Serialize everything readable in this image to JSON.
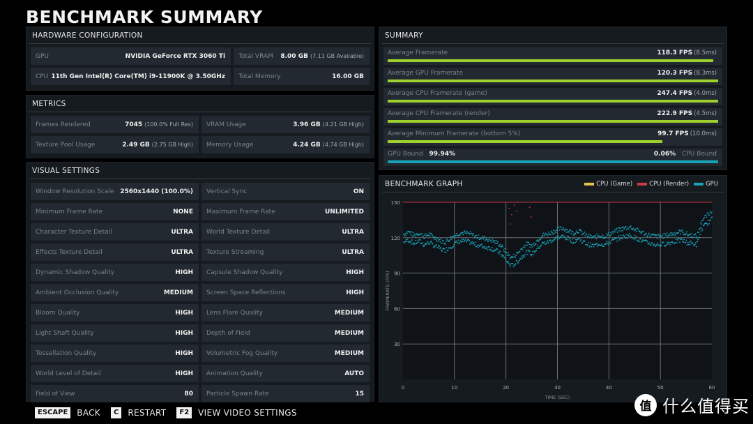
{
  "title": "BENCHMARK SUMMARY",
  "hardware": {
    "title": "HARDWARE CONFIGURATION",
    "items": [
      {
        "label": "GPU",
        "value": "NVIDIA GeForce RTX 3060 Ti",
        "sub": ""
      },
      {
        "label": "Total VRAM",
        "value": "8.00 GB",
        "sub": "(7.11 GB Available)"
      },
      {
        "label": "CPU",
        "value": "11th Gen Intel(R) Core(TM) i9-11900K @ 3.50GHz",
        "sub": ""
      },
      {
        "label": "Total Memory",
        "value": "16.00 GB",
        "sub": ""
      }
    ]
  },
  "metrics": {
    "title": "METRICS",
    "items": [
      {
        "label": "Frames Rendered",
        "value": "7045",
        "sub": "(100.0% Full Res)"
      },
      {
        "label": "VRAM Usage",
        "value": "3.96 GB",
        "sub": "(4.21 GB High)"
      },
      {
        "label": "Texture Pool Usage",
        "value": "2.49 GB",
        "sub": "(2.75 GB High)"
      },
      {
        "label": "Memory Usage",
        "value": "4.24 GB",
        "sub": "(4.74 GB High)"
      }
    ]
  },
  "visual": {
    "title": "VISUAL SETTINGS",
    "items": [
      {
        "label": "Window Resolution Scale",
        "value": "2560x1440 (100.0%)"
      },
      {
        "label": "Vertical Sync",
        "value": "ON"
      },
      {
        "label": "Minimum Frame Rate",
        "value": "NONE"
      },
      {
        "label": "Maximum Frame Rate",
        "value": "UNLIMITED"
      },
      {
        "label": "Character Texture Detail",
        "value": "ULTRA"
      },
      {
        "label": "World Texture Detail",
        "value": "ULTRA"
      },
      {
        "label": "Effects Texture Detail",
        "value": "ULTRA"
      },
      {
        "label": "Texture Streaming",
        "value": "ULTRA"
      },
      {
        "label": "Dynamic Shadow Quality",
        "value": "HIGH"
      },
      {
        "label": "Capsule Shadow Quality",
        "value": "HIGH"
      },
      {
        "label": "Ambient Occlusion Quality",
        "value": "MEDIUM"
      },
      {
        "label": "Screen Space Reflections",
        "value": "HIGH"
      },
      {
        "label": "Bloom Quality",
        "value": "HIGH"
      },
      {
        "label": "Lens Flare Quality",
        "value": "MEDIUM"
      },
      {
        "label": "Light Shaft Quality",
        "value": "HIGH"
      },
      {
        "label": "Depth of Field",
        "value": "MEDIUM"
      },
      {
        "label": "Tessellation Quality",
        "value": "HIGH"
      },
      {
        "label": "Volumetric Fog Quality",
        "value": "MEDIUM"
      },
      {
        "label": "World Level of Detail",
        "value": "HIGH"
      },
      {
        "label": "Animation Quality",
        "value": "AUTO"
      },
      {
        "label": "Field of View",
        "value": "80"
      },
      {
        "label": "Particle Spawn Rate",
        "value": "15"
      }
    ]
  },
  "summary": {
    "title": "SUMMARY",
    "rows": [
      {
        "label": "Average Framerate",
        "value": "118.3 FPS",
        "sub": "(8.5ms)",
        "fill": 0.985
      },
      {
        "label": "Average GPU Framerate",
        "value": "120.3 FPS",
        "sub": "(8.3ms)",
        "fill": 1.0
      },
      {
        "label": "Average CPU Framerate (game)",
        "value": "247.4 FPS",
        "sub": "(4.0ms)",
        "fill": 1.0
      },
      {
        "label": "Average CPU Framerate (render)",
        "value": "222.9 FPS",
        "sub": "(4.5ms)",
        "fill": 1.0
      },
      {
        "label": "Average Minimum Framerate (bottom 5%)",
        "value": "99.7 FPS",
        "sub": "(10.0ms)",
        "fill": 0.831
      }
    ],
    "bound": {
      "gpu_label": "GPU Bound",
      "gpu_value": "99.94%",
      "cpu_value": "0.06%",
      "cpu_label": "CPU Bound",
      "fill": 0.9994
    }
  },
  "colors": {
    "green": "#9ed02d",
    "cyan": "#17a2b6",
    "cpu_game": "#e8c545",
    "cpu_render": "#d03a45"
  },
  "chart_data": {
    "type": "scatter",
    "title": "BENCHMARK GRAPH",
    "xlabel": "TIME (SEC)",
    "ylabel": "FRAMERATE (FPS)",
    "xlim": [
      0,
      60
    ],
    "ylim": [
      0,
      150
    ],
    "xticks": [
      0,
      10,
      20,
      30,
      40,
      50,
      60
    ],
    "yticks": [
      30,
      60,
      90,
      120,
      150
    ],
    "grid": true,
    "legend": {
      "position": "top-right",
      "entries": [
        {
          "name": "CPU (Game)",
          "color": "#e8c545"
        },
        {
          "name": "CPU (Render)",
          "color": "#d03a45"
        },
        {
          "name": "GPU",
          "color": "#17a2b6"
        }
      ]
    },
    "series": [
      {
        "name": "GPU",
        "color": "#17a2b6",
        "x": [
          0,
          1,
          2,
          3,
          4,
          5,
          6,
          7,
          8,
          9,
          10,
          11,
          12,
          13,
          14,
          15,
          16,
          17,
          18,
          19,
          20,
          21,
          22,
          23,
          24,
          25,
          26,
          27,
          28,
          29,
          30,
          31,
          32,
          33,
          34,
          35,
          36,
          37,
          38,
          39,
          40,
          41,
          42,
          43,
          44,
          45,
          46,
          47,
          48,
          49,
          50,
          51,
          52,
          53,
          54,
          55,
          56,
          57,
          58,
          59,
          60
        ],
        "y": [
          120,
          122,
          119,
          121,
          118,
          120,
          117,
          115,
          113,
          116,
          119,
          121,
          121,
          120,
          118,
          117,
          116,
          115,
          113,
          110,
          104,
          100,
          103,
          108,
          112,
          110,
          115,
          119,
          120,
          122,
          124,
          125,
          123,
          121,
          123,
          120,
          118,
          117,
          119,
          118,
          120,
          122,
          124,
          125,
          126,
          124,
          122,
          120,
          119,
          118,
          118,
          119,
          120,
          121,
          122,
          120,
          119,
          118,
          132,
          136,
          140
        ]
      },
      {
        "name": "CPU (Render)",
        "color": "#d03a45",
        "x": [
          0,
          60
        ],
        "y": [
          150,
          150
        ]
      },
      {
        "name": "CPU (Game)",
        "color": "#e8c545",
        "x": [],
        "y": []
      }
    ]
  },
  "footer": [
    {
      "key": "ESCAPE",
      "action": "BACK"
    },
    {
      "key": "C",
      "action": "RESTART"
    },
    {
      "key": "F2",
      "action": "VIEW VIDEO SETTINGS"
    }
  ],
  "watermark": {
    "logo": "值",
    "text": "什么值得买"
  }
}
